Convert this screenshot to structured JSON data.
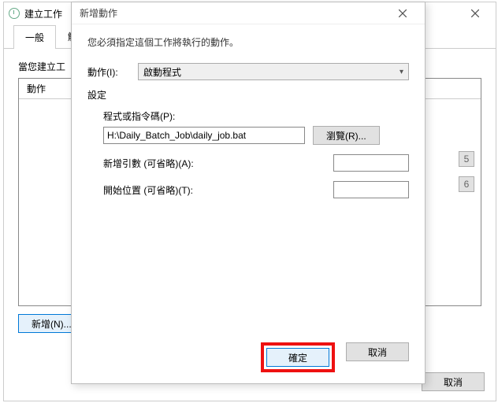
{
  "parent": {
    "title": "建立工作",
    "tabs": {
      "general": "一般",
      "triggers": "觸發"
    },
    "body_label": "當您建立工",
    "list_header": "動作",
    "new_button": "新增(N)...",
    "cancel_button": "取消",
    "page5": "5",
    "page6": "6"
  },
  "dialog": {
    "title": "新增動作",
    "instruction": "您必須指定這個工作將執行的動作。",
    "action_label": "動作(I):",
    "action_value": "啟動程式",
    "settings_label": "設定",
    "program_label": "程式或指令碼(P):",
    "program_value": "H:\\Daily_Batch_Job\\daily_job.bat",
    "browse_button": "瀏覽(R)...",
    "args_label": "新增引數 (可省略)(A):",
    "args_value": "",
    "startin_label": "開始位置 (可省略)(T):",
    "startin_value": "",
    "ok_button": "確定",
    "cancel_button": "取消"
  }
}
